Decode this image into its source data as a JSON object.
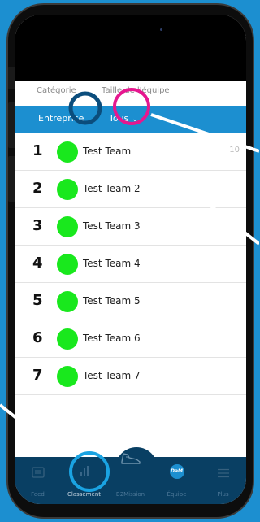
{
  "filter": {
    "category_label": "Catégorie",
    "team_size_label": "Taille de l'équipe",
    "category_value": "Entreprise",
    "team_size_value": "Tous",
    "chevron": "⌄"
  },
  "teams": [
    {
      "rank": "1",
      "name": "Test Team",
      "score": "10"
    },
    {
      "rank": "2",
      "name": "Test Team 2"
    },
    {
      "rank": "3",
      "name": "Test Team 3"
    },
    {
      "rank": "4",
      "name": "Test Team 4"
    },
    {
      "rank": "5",
      "name": "Test Team 5"
    },
    {
      "rank": "6",
      "name": "Test Team 6"
    },
    {
      "rank": "7",
      "name": "Test Team 7"
    }
  ],
  "tabs": [
    {
      "label": "Feed",
      "icon": "feed-icon"
    },
    {
      "label": "Classement",
      "icon": "bar-chart-icon"
    },
    {
      "label": "B2Mission",
      "icon": "sneaker-icon"
    },
    {
      "label": "Équipe",
      "icon": "dam-badge-icon",
      "badge": "DaM"
    },
    {
      "label": "Plus",
      "icon": "menu-icon"
    }
  ],
  "colors": {
    "brand_blue": "#1c8fd0",
    "tab_bar": "#093f63",
    "avatar_green": "#19e81d",
    "highlight_navy": "#0b4d7c",
    "highlight_magenta": "#e6178f",
    "highlight_cyan": "#1aa3e2"
  }
}
